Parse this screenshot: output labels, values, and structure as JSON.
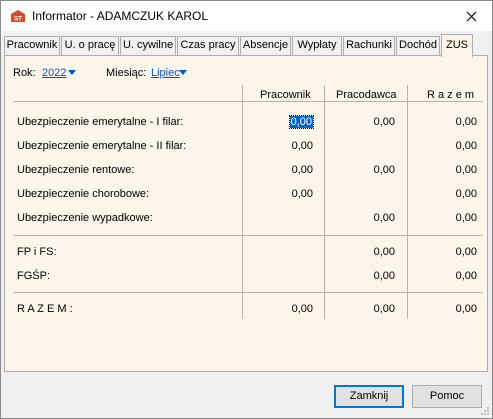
{
  "window": {
    "title": "Informator - ADAMCZUK KAROL",
    "icon": "app-logo-icon",
    "close_icon": "close-icon"
  },
  "tabs": [
    {
      "label": "Pracownik"
    },
    {
      "label": "U. o pracę"
    },
    {
      "label": "U. cywilne"
    },
    {
      "label": "Czas pracy"
    },
    {
      "label": "Absencje"
    },
    {
      "label": "Wypłaty"
    },
    {
      "label": "Rachunki"
    },
    {
      "label": "Dochód"
    },
    {
      "label": "ZUS",
      "active": true
    }
  ],
  "filters": {
    "year_label": "Rok:",
    "year_value": "2022",
    "month_label": "Miesiąc:",
    "month_value": "Lipiec"
  },
  "table": {
    "headers": {
      "employee": "Pracownik",
      "employer": "Pracodawca",
      "total": "R a z e m"
    },
    "rows": [
      {
        "label": "Ubezpieczenie emerytalne - I filar:",
        "employee": "0,00",
        "employer": "0,00",
        "total": "0,00"
      },
      {
        "label": "Ubezpieczenie emerytalne - II filar:",
        "employee": "0,00",
        "employer": "",
        "total": "0,00"
      },
      {
        "label": "Ubezpieczenie rentowe:",
        "employee": "0,00",
        "employer": "0,00",
        "total": "0,00"
      },
      {
        "label": "Ubezpieczenie chorobowe:",
        "employee": "0,00",
        "employer": "",
        "total": "0,00"
      },
      {
        "label": "Ubezpieczenie wypadkowe:",
        "employee": "",
        "employer": "0,00",
        "total": "0,00"
      },
      {
        "label": "FP i FS:",
        "employee": "",
        "employer": "0,00",
        "total": "0,00"
      },
      {
        "label": "FGŚP:",
        "employee": "",
        "employer": "0,00",
        "total": "0,00"
      },
      {
        "label": "R A Z E M :",
        "employee": "0,00",
        "employer": "0,00",
        "total": "0,00"
      }
    ]
  },
  "buttons": {
    "close": "Zamknij",
    "help": "Pomoc"
  },
  "colors": {
    "panel_bg": "#fbf6e9",
    "link": "#0055cc",
    "selection": "#0066cc"
  }
}
